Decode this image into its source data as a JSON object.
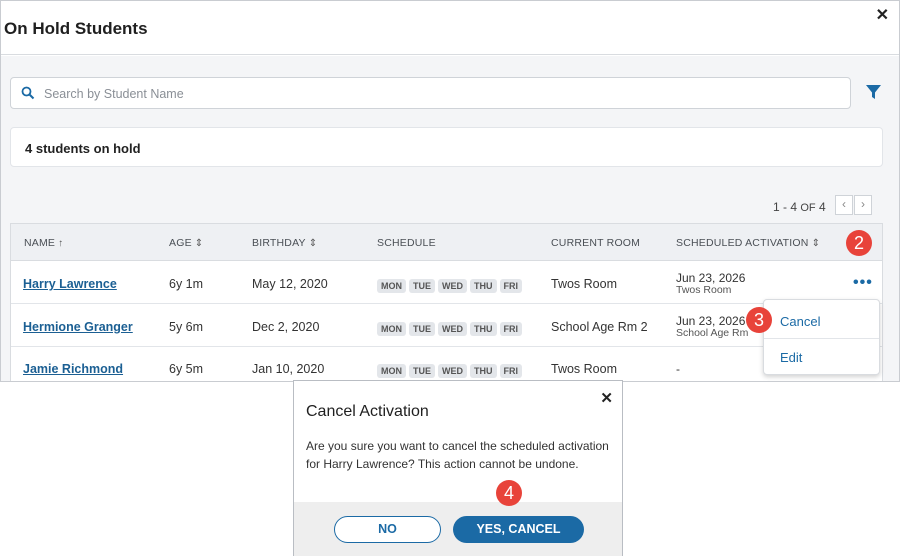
{
  "panel": {
    "title": "On Hold Students",
    "close_icon": "close-icon"
  },
  "search": {
    "placeholder": "Search by Student Name",
    "value": "",
    "icon": "search-icon"
  },
  "filter": {
    "icon": "filter-icon",
    "color": "#1b6aa5"
  },
  "summary": {
    "count_text": "4 students on hold"
  },
  "pagination": {
    "range": "1 - 4",
    "of_label": "OF",
    "total": "4"
  },
  "table": {
    "columns": [
      "NAME",
      "AGE",
      "BIRTHDAY",
      "SCHEDULE",
      "CURRENT ROOM",
      "SCHEDULED ACTIVATION"
    ],
    "rows": [
      {
        "name": "Harry Lawrence",
        "age": "6y 1m",
        "birthday": "May 12, 2020",
        "days": [
          "MON",
          "TUE",
          "WED",
          "THU",
          "FRI"
        ],
        "room": "Twos Room",
        "activation_date": "Jun 23, 2026",
        "activation_room": "Twos Room"
      },
      {
        "name": "Hermione Granger",
        "age": "5y 6m",
        "birthday": "Dec 2, 2020",
        "days": [
          "MON",
          "TUE",
          "WED",
          "THU",
          "FRI"
        ],
        "room": "School Age Rm 2",
        "activation_date": "Jun 23, 2026",
        "activation_room": "School Age Rm"
      },
      {
        "name": "Jamie Richmond",
        "age": "6y 5m",
        "birthday": "Jan 10, 2020",
        "days": [
          "MON",
          "TUE",
          "WED",
          "THU",
          "FRI"
        ],
        "room": "Twos Room",
        "activation_date": "-",
        "activation_room": ""
      }
    ]
  },
  "row_menu": {
    "items": [
      "Cancel",
      "Edit"
    ],
    "trigger": "•••"
  },
  "badges": [
    "2",
    "3",
    "4"
  ],
  "dialog": {
    "title": "Cancel Activation",
    "message": "Are you sure you want to cancel the scheduled activation for Harry Lawrence? This action cannot be undone.",
    "no_label": "NO",
    "yes_label": "YES, CANCEL"
  },
  "colors": {
    "accent": "#1b6aa5",
    "badge": "#e8433a",
    "link": "#1b5f93"
  }
}
